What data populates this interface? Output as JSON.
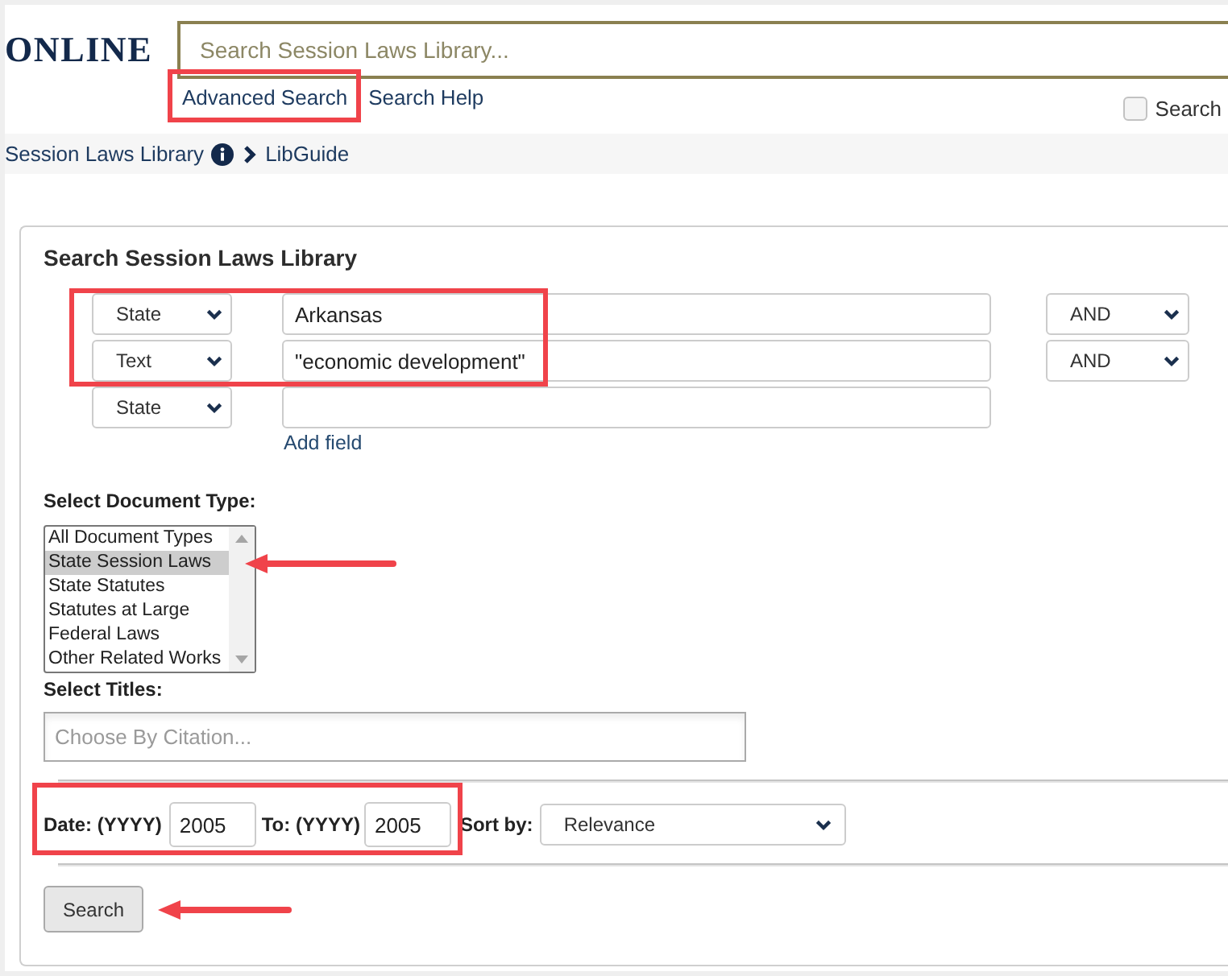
{
  "header": {
    "logo": "ONLINE",
    "search": {
      "placeholder": "Search Session Laws Library..."
    },
    "links": [
      {
        "label": "Advanced Search",
        "highlighted": true
      },
      {
        "label": "Search Help",
        "highlighted": false
      }
    ],
    "option": {
      "label": "Search",
      "checked": false
    }
  },
  "breadcrumb": [
    {
      "label": "Session Laws Library",
      "info_icon": true
    },
    {
      "label": "LibGuide",
      "info_icon": false
    }
  ],
  "search_form": {
    "title": "Search Session Laws Library",
    "rows": [
      {
        "field": "State",
        "value": "Arkansas",
        "operator": "AND",
        "highlighted": true
      },
      {
        "field": "Text",
        "value": "\"economic development\"",
        "operator": "AND",
        "highlighted": true
      },
      {
        "field": "State",
        "highlighted": false
      }
    ],
    "add_field": "Add field",
    "document_type": {
      "label": "Select Document Type:",
      "options": [
        {
          "label": "All Document Types",
          "selected": false
        },
        {
          "label": "State Session Laws",
          "selected": true
        },
        {
          "label": "State Statutes",
          "selected": false
        },
        {
          "label": "Statutes at Large",
          "selected": false
        },
        {
          "label": "Federal Laws",
          "selected": false
        },
        {
          "label": "Other Related Works",
          "selected": false
        }
      ],
      "arrow": true
    },
    "titles": {
      "label": "Select Titles:",
      "placeholder": "Choose By Citation..."
    },
    "date_range": {
      "from_label": "Date: (YYYY)",
      "from_value": "2005",
      "to_label": "To: (YYYY)",
      "to_value": "2005",
      "highlighted": true
    },
    "sort": {
      "label": "Sort by:",
      "value": "Relevance"
    },
    "submit": {
      "label": "Search",
      "arrow": true
    }
  }
}
